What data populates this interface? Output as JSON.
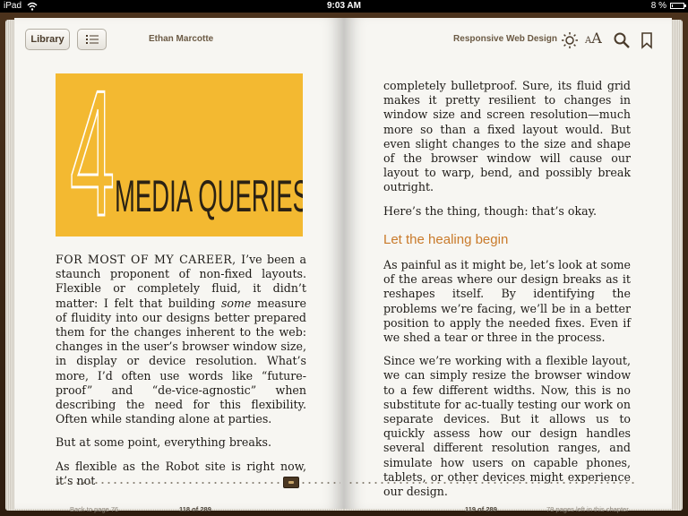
{
  "status_bar": {
    "carrier": "iPad",
    "time": "9:03 AM",
    "battery": "8 %",
    "battery_fraction": 0.08
  },
  "toolbar": {
    "library_label": "Library",
    "author": "Ethan Marcotte",
    "book_title": "Responsive Web Design",
    "font_small": "A",
    "font_large": "A"
  },
  "chapter": {
    "number": "4",
    "title": "MEDIA QUERIES"
  },
  "left_page": {
    "lead_in": "FOR MOST OF MY CAREER,",
    "p1_a": " I’ve been a staunch proponent of non-fixed layouts. Flexible or completely fluid, it didn’t matter: I felt that building ",
    "p1_em": "some",
    "p1_b": " measure of fluidity into our designs better prepared them for the changes inherent to the web: changes in the user’s browser window size, in display or device resolution. What’s more, I’d often use words like “future-proof” and “de-vice-agnostic” when describing the need for this flexibility. Often while standing alone at parties.",
    "p2": "But at some point, everything breaks.",
    "p3": "As flexible as the Robot site is right now, it’s not"
  },
  "right_page": {
    "p1": "completely bulletproof. Sure, its fluid grid makes it pretty resilient to changes in window size and screen resolution—much more so than a fixed layout would. But even slight changes to the size and shape of the browser window will cause our layout to warp, bend, and possibly break outright.",
    "p2": "Here’s the thing, though: that’s okay.",
    "heading": "Let the healing begin",
    "p3": "As painful as it might be, let’s look at some of the areas where our design breaks as it reshapes itself. By identifying the problems we’re facing, we’ll be in a better position to apply the needed fixes. Even if we shed a tear or three in the process.",
    "p4": "Since we’re working with a flexible layout, we can simply resize the browser window to a few different widths. Now, this is no substitute for ac-tually testing our work on separate devices. But it allows us to quickly assess how our design handles several different resolution ranges, and simulate how users on capable phones, tablets, or other devices might experience our design."
  },
  "footer": {
    "back_link": "Back to page 76",
    "left_page_number": "118 of 289",
    "right_page_number": "119 of 289",
    "pages_left": "78 pages left in this chapter"
  },
  "colors": {
    "banner": "#f3b931",
    "heading": "#c97a2a",
    "page": "#f7f6f2"
  }
}
